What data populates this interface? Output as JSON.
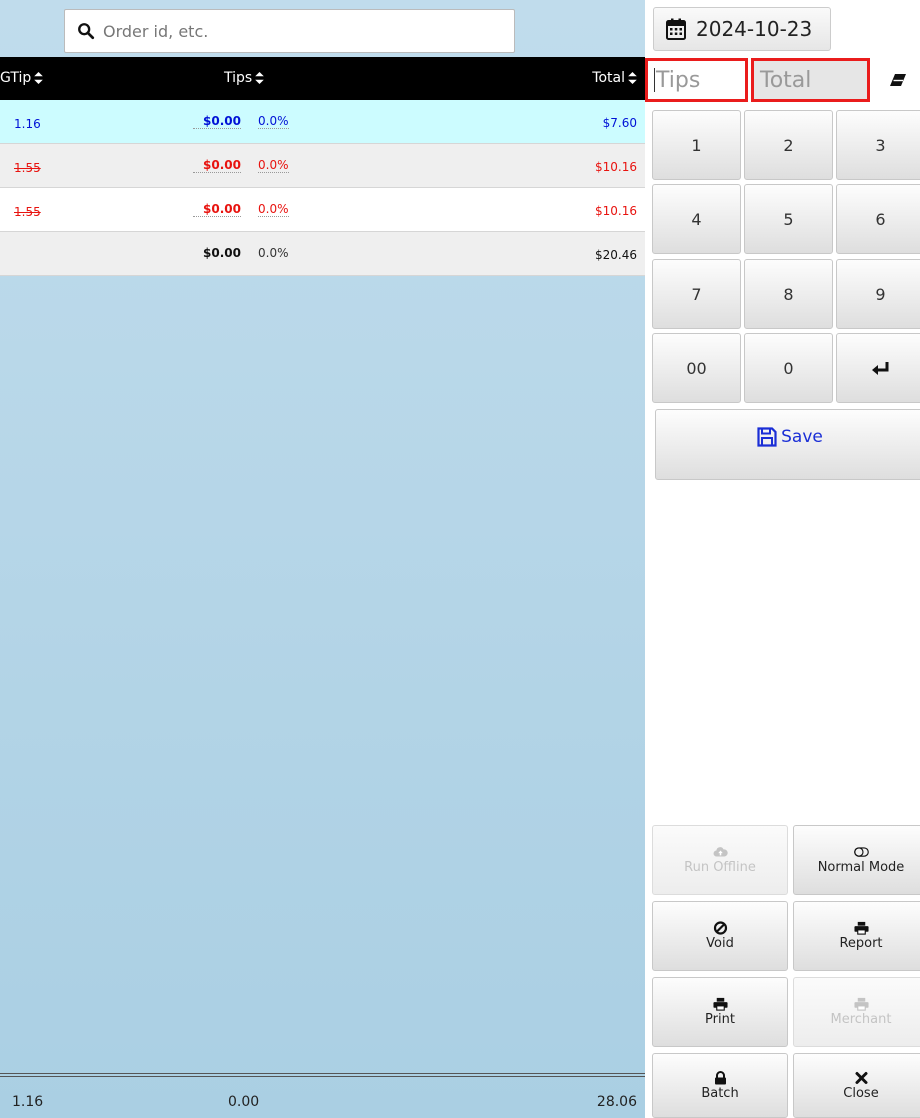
{
  "search": {
    "placeholder": "Order id, etc."
  },
  "table": {
    "columns": {
      "gtip": "GTip",
      "tips": "Tips",
      "total": "Total"
    },
    "rows": [
      {
        "gtip": "1.16",
        "tip_amount": "$0.00",
        "tip_percent": "0.0%",
        "total": "$7.60",
        "style": "blue"
      },
      {
        "gtip": "1.55",
        "tip_amount": "$0.00",
        "tip_percent": "0.0%",
        "total": "$10.16",
        "style": "red-gray"
      },
      {
        "gtip": "1.55",
        "tip_amount": "$0.00",
        "tip_percent": "0.0%",
        "total": "$10.16",
        "style": "red-white"
      }
    ],
    "summary": {
      "gtip": "",
      "tip_amount": "$0.00",
      "tip_percent": "0.0%",
      "total": "$20.46"
    }
  },
  "footer": {
    "gtip": "1.16",
    "tips": "0.00",
    "total": "28.06"
  },
  "date_picker": {
    "value": "2024-10-23",
    "icon": "calendar-icon"
  },
  "entry": {
    "tips_placeholder": "Tips",
    "total_placeholder": "Total",
    "clear_icon": "eraser-icon"
  },
  "keypad": {
    "keys": [
      "1",
      "2",
      "3",
      "4",
      "5",
      "6",
      "7",
      "8",
      "9",
      "00",
      "0"
    ],
    "enter_icon": "enter-icon"
  },
  "save": {
    "label": "Save",
    "icon": "floppy-disk-icon"
  },
  "actions": {
    "run_offline": {
      "label": "Run Offline",
      "icon": "cloud-upload-icon",
      "enabled": false
    },
    "normal_mode": {
      "label": "Normal Mode",
      "icon": "toggle-icon",
      "enabled": true
    },
    "void": {
      "label": "Void",
      "icon": "ban-icon",
      "enabled": true
    },
    "report": {
      "label": "Report",
      "icon": "printer-icon",
      "enabled": true
    },
    "print": {
      "label": "Print",
      "icon": "printer-icon",
      "enabled": true
    },
    "merchant": {
      "label": "Merchant",
      "icon": "printer-icon",
      "enabled": false
    },
    "batch": {
      "label": "Batch",
      "icon": "lock-icon",
      "enabled": true
    },
    "close": {
      "label": "Close",
      "icon": "close-icon",
      "enabled": true
    }
  },
  "colors": {
    "accent_blue": "#0012d6",
    "void_red": "#e8130f",
    "selected_row": "#ccfcff",
    "highlight_border": "#ea1c1c"
  }
}
